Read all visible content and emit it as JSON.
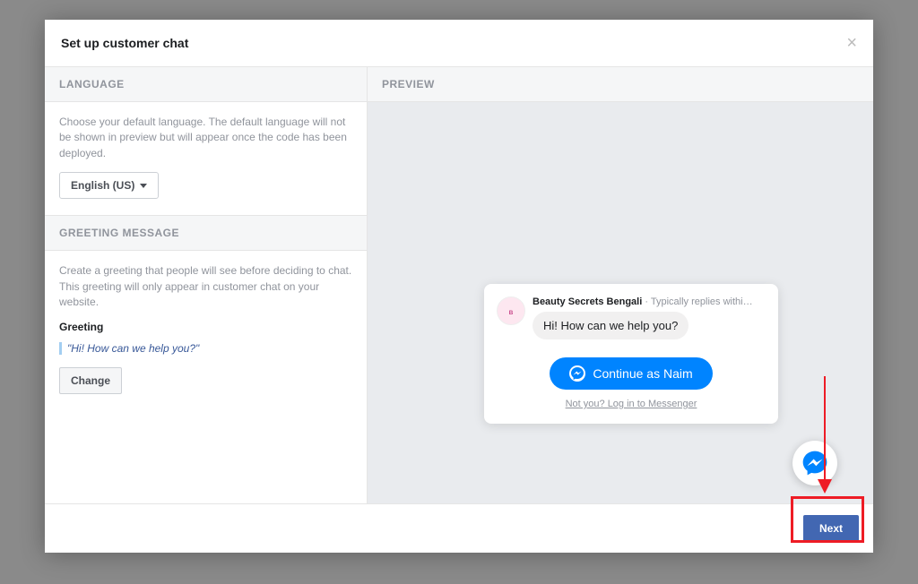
{
  "modal": {
    "title": "Set up customer chat",
    "close_glyph": "×"
  },
  "language": {
    "header": "LANGUAGE",
    "help": "Choose your default language. The default language will not be shown in preview but will appear once the code has been deployed.",
    "selected": "English (US)"
  },
  "greeting": {
    "header": "GREETING MESSAGE",
    "help": "Create a greeting that people will see before deciding to chat. This greeting will only appear in customer chat on your website.",
    "label": "Greeting",
    "text": "\"Hi! How can we help you?\"",
    "change_label": "Change"
  },
  "preview": {
    "header": "PREVIEW",
    "page_name": "Beauty Secrets Bengali",
    "reply_time": "Typically replies withi…",
    "bubble": "Hi! How can we help you?",
    "continue_label": "Continue as Naim",
    "not_you": "Not you? Log in to Messenger"
  },
  "footer": {
    "next_label": "Next"
  },
  "colors": {
    "messenger": "#0084ff",
    "fb_primary": "#4267b2",
    "annotation": "#ee1c25"
  }
}
